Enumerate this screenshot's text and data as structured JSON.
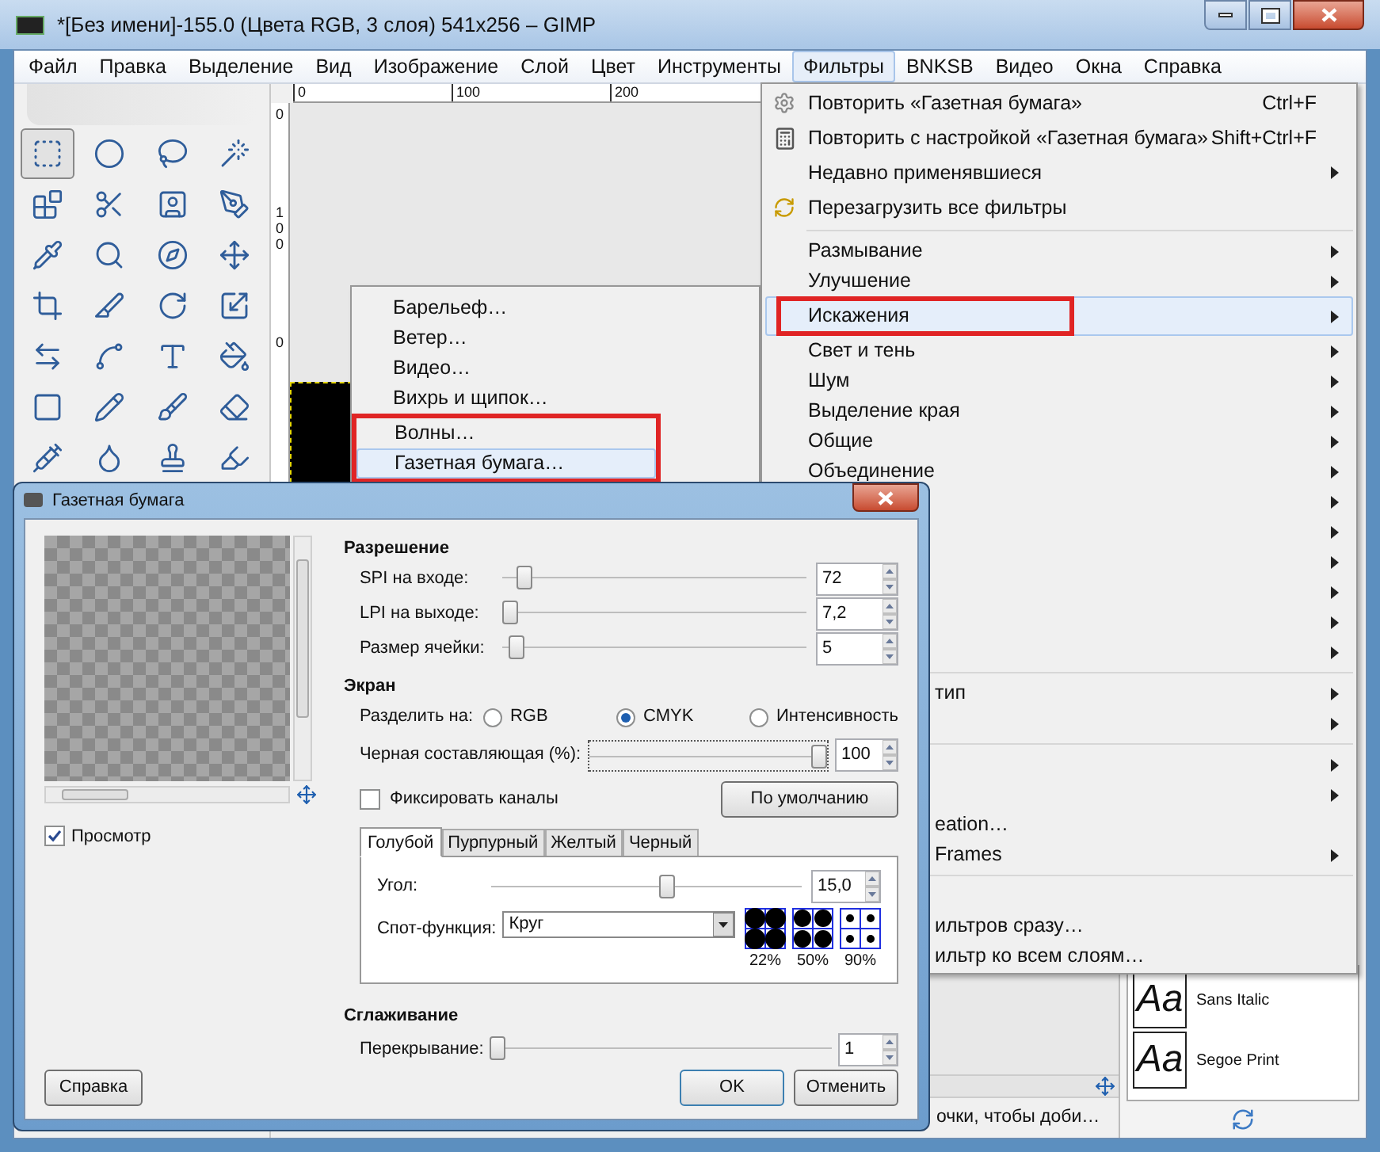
{
  "window": {
    "title": "*[Без имени]-155.0 (Цвета RGB, 3 слоя) 541x256 – GIMP"
  },
  "menubar": [
    {
      "label": "Файл",
      "selected": false
    },
    {
      "label": "Правка",
      "selected": false
    },
    {
      "label": "Выделение",
      "selected": false
    },
    {
      "label": "Вид",
      "selected": false
    },
    {
      "label": "Изображение",
      "selected": false
    },
    {
      "label": "Слой",
      "selected": false
    },
    {
      "label": "Цвет",
      "selected": false
    },
    {
      "label": "Инструменты",
      "selected": false
    },
    {
      "label": "Фильтры",
      "selected": true
    },
    {
      "label": "BNKSB",
      "selected": false
    },
    {
      "label": "Видео",
      "selected": false
    },
    {
      "label": "Окна",
      "selected": false
    },
    {
      "label": "Справка",
      "selected": false
    }
  ],
  "toolbox": {
    "tools": [
      {
        "selected": true
      },
      {
        "selected": false
      },
      {
        "selected": false
      },
      {
        "selected": false
      },
      {
        "selected": false
      },
      {
        "selected": false
      },
      {
        "selected": false
      },
      {
        "selected": false
      },
      {
        "selected": false
      },
      {
        "selected": false
      },
      {
        "selected": false
      },
      {
        "selected": false
      },
      {
        "selected": false
      },
      {
        "selected": false
      },
      {
        "selected": false
      },
      {
        "selected": false
      },
      {
        "selected": false
      },
      {
        "selected": false
      },
      {
        "selected": false
      },
      {
        "selected": false
      },
      {
        "selected": false
      },
      {
        "selected": false
      },
      {
        "selected": false
      },
      {
        "selected": false
      },
      {
        "selected": false
      },
      {
        "selected": false
      },
      {
        "selected": false
      },
      {
        "selected": false
      }
    ]
  },
  "canvas": {
    "top_ruler": [
      "0",
      "100",
      "200"
    ],
    "left_ruler": [
      "0",
      "100",
      "0"
    ]
  },
  "status_text": "очки, чтобы доби…",
  "fonts_panel": {
    "fonts": [
      {
        "sample": "Aa",
        "name": "Sans Italic"
      },
      {
        "sample": "Aa",
        "name": "Segoe Print"
      }
    ]
  },
  "filters_menu": {
    "items": [
      {
        "kind": "item",
        "label": "Повторить «Газетная бумага»",
        "shortcut": "Ctrl+F",
        "submenu": false,
        "selected": false
      },
      {
        "kind": "item",
        "label": "Повторить с настройкой «Газетная бумага»",
        "shortcut": "Shift+Ctrl+F",
        "submenu": false,
        "selected": false
      },
      {
        "kind": "item",
        "label": "Недавно применявшиеся",
        "submenu": true,
        "selected": false
      },
      {
        "kind": "item",
        "label": "Перезагрузить все фильтры",
        "submenu": false,
        "selected": false
      },
      {
        "kind": "separator"
      },
      {
        "kind": "item",
        "label": "Размывание",
        "submenu": true,
        "selected": false
      },
      {
        "kind": "item",
        "label": "Улучшение",
        "submenu": true,
        "selected": false
      },
      {
        "kind": "item",
        "label": "Искажения",
        "submenu": true,
        "selected": true
      },
      {
        "kind": "item",
        "label": "Свет и тень",
        "submenu": true,
        "selected": false
      },
      {
        "kind": "item",
        "label": "Шум",
        "submenu": true,
        "selected": false
      },
      {
        "kind": "item",
        "label": "Выделение края",
        "submenu": true,
        "selected": false
      },
      {
        "kind": "item",
        "label": "Общие",
        "submenu": true,
        "selected": false
      },
      {
        "kind": "item",
        "label": "Объединение",
        "submenu": true,
        "selected": false
      },
      {
        "kind": "partial",
        "submenu": true,
        "selected": false
      },
      {
        "kind": "partial",
        "submenu": true,
        "selected": false
      },
      {
        "kind": "partial",
        "submenu": true,
        "selected": false
      },
      {
        "kind": "partial",
        "submenu": true,
        "selected": false
      },
      {
        "kind": "partial",
        "submenu": true,
        "selected": false
      },
      {
        "kind": "partial",
        "submenu": true,
        "selected": false
      },
      {
        "kind": "separator"
      },
      {
        "kind": "partial",
        "label": "тип",
        "submenu": true,
        "selected": false
      },
      {
        "kind": "partial",
        "submenu": true,
        "selected": false
      },
      {
        "kind": "separator"
      },
      {
        "kind": "partial",
        "submenu": true,
        "selected": false
      },
      {
        "kind": "partial",
        "submenu": true,
        "selected": false
      },
      {
        "kind": "partial",
        "label": "eation…",
        "submenu": false,
        "selected": false
      },
      {
        "kind": "partial",
        "label": "Frames",
        "submenu": true,
        "selected": false
      },
      {
        "kind": "separator"
      },
      {
        "kind": "partial",
        "submenu": false,
        "selected": false
      },
      {
        "kind": "partial",
        "label": "ильтров сразу…",
        "submenu": false,
        "selected": false
      },
      {
        "kind": "partial",
        "label": "ильтр ко всем слоям…",
        "submenu": false,
        "selected": false
      }
    ]
  },
  "distort_submenu": {
    "items": [
      {
        "label": "Барельеф…",
        "selected": false
      },
      {
        "label": "Ветер…",
        "selected": false
      },
      {
        "label": "Видео…",
        "selected": false
      },
      {
        "label": "Вихрь и щипок…",
        "selected": false
      },
      {
        "label": "Волны…",
        "selected": false
      },
      {
        "label": "Газетная бумага…",
        "selected": true
      }
    ]
  },
  "dialog": {
    "title": "Газетная бумага",
    "preview": {
      "label": "Просмотр",
      "checked": true
    },
    "resolution": {
      "heading": "Разрешение",
      "rows": [
        {
          "label": "SPI на входе:",
          "level": 0.05,
          "value": "72"
        },
        {
          "label": "LPI на выходе:",
          "level": 0.0,
          "value": "7,2"
        },
        {
          "label": "Размер ячейки:",
          "level": 0.02,
          "value": "5"
        }
      ]
    },
    "screen": {
      "heading": "Экран",
      "separate_label": "Разделить на:",
      "options": [
        {
          "label": "RGB",
          "selected": false
        },
        {
          "label": "CMYK",
          "selected": true
        },
        {
          "label": "Интенсивность",
          "selected": false
        }
      ],
      "black": {
        "label": "Черная составляющая (%):",
        "level": 1.0,
        "value": "100"
      },
      "lock": {
        "label": "Фиксировать каналы",
        "checked": false
      },
      "default_button": "По умолчанию",
      "tabs": [
        {
          "label": "Голубой",
          "selected": true
        },
        {
          "label": "Пурпурный",
          "selected": false
        },
        {
          "label": "Желтый",
          "selected": false
        },
        {
          "label": "Черный",
          "selected": false
        }
      ],
      "angle": {
        "label": "Угол:",
        "level": 0.57,
        "value": "15,0"
      },
      "spot": {
        "label": "Спот-функция:",
        "value": "Круг"
      },
      "samples": [
        {
          "label": "22%"
        },
        {
          "label": "50%"
        },
        {
          "label": "90%"
        }
      ]
    },
    "antialiasing": {
      "heading": "Сглаживание",
      "oversample": {
        "label": "Перекрывание:",
        "level": 0.0,
        "value": "1"
      }
    },
    "buttons": {
      "help": "Справка",
      "ok": "OK",
      "cancel": "Отменить"
    }
  }
}
